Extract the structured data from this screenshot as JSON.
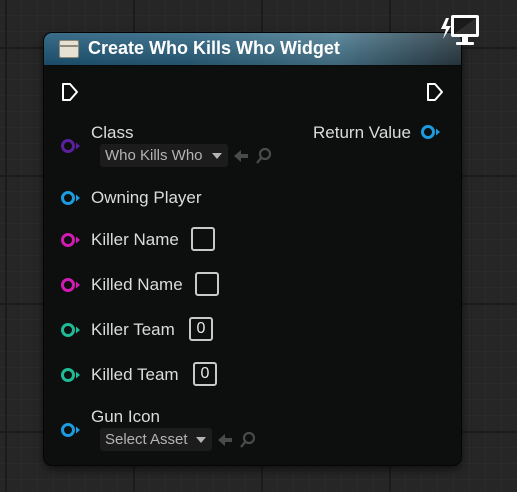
{
  "node": {
    "title": "Create Who Kills Who Widget",
    "title_icon": "widget-icon",
    "badge_icon": "network-monitor-icon"
  },
  "pins": {
    "class_label": "Class",
    "class_value": "Who Kills Who",
    "return_label": "Return Value",
    "owning_player_label": "Owning Player",
    "killer_name_label": "Killer Name",
    "killer_name_value": "",
    "killed_name_label": "Killed Name",
    "killed_name_value": "",
    "killer_team_label": "Killer Team",
    "killer_team_value": "0",
    "killed_team_label": "Killed Team",
    "killed_team_value": "0",
    "gun_icon_label": "Gun Icon",
    "gun_icon_value": "Select Asset"
  },
  "colors": {
    "class_pin": "#5c1f9e",
    "object_pin": "#1b9be0",
    "text_pin": "#d21ab4",
    "int_pin": "#1fbb96",
    "exec_pin": "#ffffff"
  }
}
